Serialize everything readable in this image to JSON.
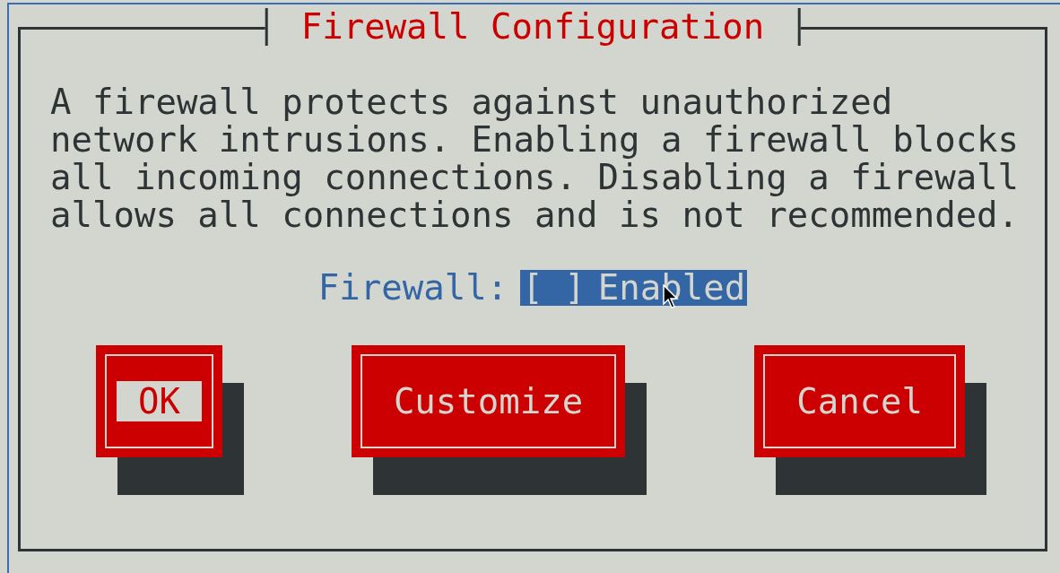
{
  "dialog": {
    "title": "Firewall Configuration",
    "description": "A firewall protects against unauthorized network intrusions. Enabling a firewall blocks all incoming connections. Disabling a firewall allows all connections and is not recommended.",
    "field": {
      "label": "Firewall:",
      "checkbox": "[ ]",
      "option": "Enabled",
      "focused": true
    },
    "buttons": [
      {
        "label": "OK",
        "focused": true
      },
      {
        "label": "Customize",
        "focused": false
      },
      {
        "label": "Cancel",
        "focused": false
      }
    ]
  }
}
